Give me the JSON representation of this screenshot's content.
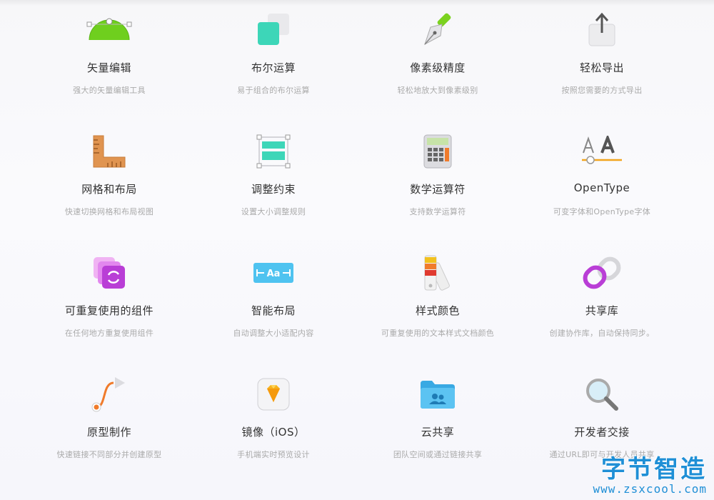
{
  "features": [
    {
      "title": "矢量编辑",
      "desc": "强大的矢量编辑工具",
      "icon": "vector-edit-icon"
    },
    {
      "title": "布尔运算",
      "desc": "易于组合的布尔运算",
      "icon": "boolean-ops-icon"
    },
    {
      "title": "像素级精度",
      "desc": "轻松地放大到像素级别",
      "icon": "pen-nib-icon"
    },
    {
      "title": "轻松导出",
      "desc": "按照您需要的方式导出",
      "icon": "export-icon"
    },
    {
      "title": "网格和布局",
      "desc": "快速切换网格和布局视图",
      "icon": "ruler-icon"
    },
    {
      "title": "调整约束",
      "desc": "设置大小调整规则",
      "icon": "resize-constraints-icon"
    },
    {
      "title": "数学运算符",
      "desc": "支持数学运算符",
      "icon": "calculator-icon"
    },
    {
      "title": "OpenType",
      "desc": "可变字体和OpenType字体",
      "icon": "typography-icon"
    },
    {
      "title": "可重复使用的组件",
      "desc": "在任何地方重复使用组件",
      "icon": "symbols-icon"
    },
    {
      "title": "智能布局",
      "desc": "自动调整大小适配内容",
      "icon": "smart-layout-icon"
    },
    {
      "title": "样式颜色",
      "desc": "可重复使用的文本样式文档颜色",
      "icon": "color-swatch-icon"
    },
    {
      "title": "共享库",
      "desc": "创建协作库，自动保持同步。",
      "icon": "link-icon"
    },
    {
      "title": "原型制作",
      "desc": "快速链接不同部分并创建原型",
      "icon": "prototype-icon"
    },
    {
      "title": "镜像（iOS）",
      "desc": "手机端实时预览设计",
      "icon": "sketch-diamond-icon"
    },
    {
      "title": "云共享",
      "desc": "团队空间或通过链接共享",
      "icon": "cloud-folder-icon"
    },
    {
      "title": "开发者交接",
      "desc": "通过URL即可与开发人员共享",
      "icon": "magnifier-icon"
    }
  ],
  "watermark": {
    "logo": "字节智造",
    "url": "www.zsxcool.com"
  },
  "colors": {
    "title": "#333333",
    "desc": "#aaaaaa",
    "watermark": "#1f8fd6"
  }
}
